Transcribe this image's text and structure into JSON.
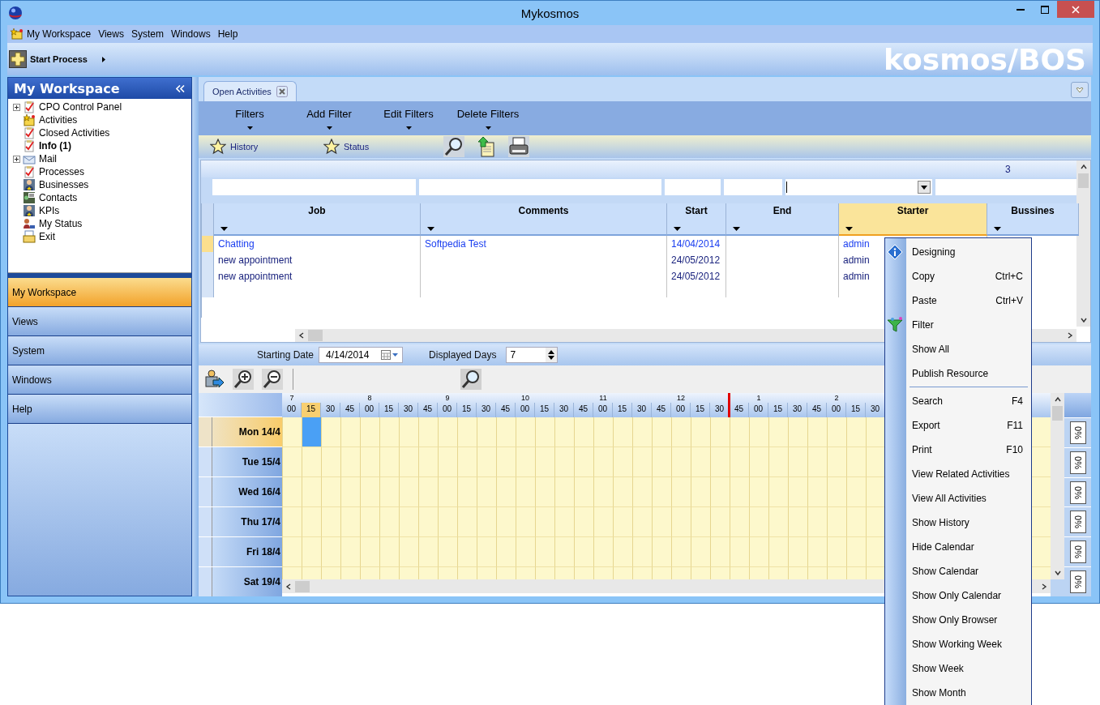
{
  "window": {
    "title": "Mykosmos"
  },
  "menu_bar": [
    {
      "label": "My Workspace"
    },
    {
      "label": "Views"
    },
    {
      "label": "System"
    },
    {
      "label": "Windows"
    },
    {
      "label": "Help"
    }
  ],
  "toolbar": {
    "start_process": "Start Process",
    "logo": "kosmos/BOS"
  },
  "sidebar": {
    "title": "My Workspace",
    "tree": [
      {
        "label": "CPO Control Panel",
        "kind": "checklist",
        "has_children": true,
        "bold": false
      },
      {
        "label": "Activities",
        "kind": "folder",
        "has_children": false,
        "bold": false
      },
      {
        "label": "Closed Activities",
        "kind": "checklist",
        "has_children": false,
        "bold": false
      },
      {
        "label": "Info (1)",
        "kind": "checklist",
        "has_children": false,
        "bold": true
      },
      {
        "label": "Mail",
        "kind": "mail",
        "has_children": true,
        "bold": false
      },
      {
        "label": "Processes",
        "kind": "checklist",
        "has_children": false,
        "bold": false
      },
      {
        "label": "Businesses",
        "kind": "person",
        "has_children": false,
        "bold": false
      },
      {
        "label": "Contacts",
        "kind": "contacts",
        "has_children": false,
        "bold": false
      },
      {
        "label": "KPIs",
        "kind": "person",
        "has_children": false,
        "bold": false
      },
      {
        "label": "My Status",
        "kind": "status",
        "has_children": false,
        "bold": false
      },
      {
        "label": "Exit",
        "kind": "exit",
        "has_children": false,
        "bold": false
      }
    ],
    "nav": [
      {
        "label": "My Workspace",
        "selected": true
      },
      {
        "label": "Views",
        "selected": false
      },
      {
        "label": "System",
        "selected": false
      },
      {
        "label": "Windows",
        "selected": false
      },
      {
        "label": "Help",
        "selected": false
      }
    ]
  },
  "tabs": [
    {
      "label": "Open Activities",
      "selected": true
    }
  ],
  "filter_menu": [
    {
      "label": "Filters"
    },
    {
      "label": "Add Filter"
    },
    {
      "label": "Edit Filters"
    },
    {
      "label": "Delete Filters"
    }
  ],
  "actions": [
    {
      "kind": "star",
      "label": "History"
    },
    {
      "kind": "star",
      "label": "Status"
    },
    {
      "kind": "search"
    },
    {
      "kind": "export"
    },
    {
      "kind": "print"
    }
  ],
  "grid": {
    "record_count": "3",
    "filters": [
      {
        "kind": "text"
      },
      {
        "kind": "text"
      },
      {
        "kind": "text"
      },
      {
        "kind": "text"
      },
      {
        "kind": "dropdown"
      },
      {
        "kind": "text"
      }
    ],
    "columns": [
      {
        "title": "Job",
        "selected": false
      },
      {
        "title": "Comments",
        "selected": false
      },
      {
        "title": "Start",
        "selected": false
      },
      {
        "title": "End",
        "selected": false
      },
      {
        "title": "Starter",
        "selected": true
      },
      {
        "title": "Bussines",
        "selected": false
      }
    ],
    "rows": [
      {
        "selected": true,
        "cells": [
          {
            "text": "Chatting"
          },
          {
            "text": "Softpedia Test"
          },
          {
            "text": "14/04/2014"
          },
          {},
          {
            "text": "admin"
          }
        ]
      },
      {
        "selected": false,
        "cells": [
          {
            "text": "new appointment"
          },
          {},
          {
            "text": "24/05/2012"
          },
          {},
          {
            "text": "admin"
          }
        ]
      },
      {
        "selected": false,
        "cells": [
          {
            "text": "new appointment"
          },
          {},
          {
            "text": "24/05/2012"
          },
          {},
          {
            "text": "admin"
          }
        ]
      }
    ]
  },
  "calendar": {
    "starting_date_label": "Starting Date",
    "starting_date": "4/14/2014",
    "days_label": "Displayed Days",
    "displayed_days": "7",
    "tools": [
      {
        "kind": "user-arrow"
      },
      {
        "kind": "zoom-in"
      },
      {
        "kind": "zoom-out"
      },
      {
        "kind": "search"
      }
    ],
    "hours": [
      {
        "label": "7",
        "minutes": [
          {
            "label": "00",
            "selected": false,
            "now": false
          },
          {
            "label": "15",
            "selected": true,
            "now": false
          },
          {
            "label": "30",
            "selected": false,
            "now": false
          },
          {
            "label": "45",
            "selected": false,
            "now": false
          }
        ]
      },
      {
        "label": "8",
        "minutes": [
          {
            "label": "00",
            "selected": false,
            "now": false
          },
          {
            "label": "15",
            "selected": false,
            "now": false
          },
          {
            "label": "30",
            "selected": false,
            "now": false
          },
          {
            "label": "45",
            "selected": false,
            "now": false
          }
        ]
      },
      {
        "label": "9",
        "minutes": [
          {
            "label": "00",
            "selected": false,
            "now": false
          },
          {
            "label": "15",
            "selected": false,
            "now": false
          },
          {
            "label": "30",
            "selected": false,
            "now": false
          },
          {
            "label": "45",
            "selected": false,
            "now": false
          }
        ]
      },
      {
        "label": "10",
        "minutes": [
          {
            "label": "00",
            "selected": false,
            "now": false
          },
          {
            "label": "15",
            "selected": false,
            "now": false
          },
          {
            "label": "30",
            "selected": false,
            "now": false
          },
          {
            "label": "45",
            "selected": false,
            "now": false
          }
        ]
      },
      {
        "label": "11",
        "minutes": [
          {
            "label": "00",
            "selected": false,
            "now": false
          },
          {
            "label": "15",
            "selected": false,
            "now": false
          },
          {
            "label": "30",
            "selected": false,
            "now": false
          },
          {
            "label": "45",
            "selected": false,
            "now": false
          }
        ]
      },
      {
        "label": "12",
        "minutes": [
          {
            "label": "00",
            "selected": false,
            "now": false
          },
          {
            "label": "15",
            "selected": false,
            "now": false
          },
          {
            "label": "30",
            "selected": false,
            "now": true
          },
          {
            "label": "45",
            "selected": false,
            "now": false
          }
        ]
      },
      {
        "label": "1",
        "minutes": [
          {
            "label": "00",
            "selected": false,
            "now": false
          },
          {
            "label": "15",
            "selected": false,
            "now": false
          },
          {
            "label": "30",
            "selected": false,
            "now": false
          },
          {
            "label": "45",
            "selected": false,
            "now": false
          }
        ]
      },
      {
        "label": "2",
        "minutes": [
          {
            "label": "00",
            "selected": false,
            "now": false
          },
          {
            "label": "15",
            "selected": false,
            "now": false
          },
          {
            "label": "30",
            "selected": false,
            "now": false
          }
        ]
      }
    ],
    "days": [
      {
        "label": "Mon 14/4",
        "selected": true,
        "load": "0%"
      },
      {
        "label": "Tue 15/4",
        "selected": false,
        "load": "0%"
      },
      {
        "label": "Wed 16/4",
        "selected": false,
        "load": "0%"
      },
      {
        "label": "Thu 17/4",
        "selected": false,
        "load": "0%"
      },
      {
        "label": "Fri 18/4",
        "selected": false,
        "load": "0%"
      },
      {
        "label": "Sat 19/4",
        "selected": false,
        "load": "0%"
      }
    ]
  },
  "context_menu": {
    "items": [
      {
        "kind": "info",
        "label": "Designing"
      },
      {
        "kind": "item",
        "label": "Copy",
        "shortcut": "Ctrl+C"
      },
      {
        "kind": "item",
        "label": "Paste",
        "shortcut": "Ctrl+V"
      },
      {
        "kind": "filter",
        "label": "Filter"
      },
      {
        "kind": "item",
        "label": "Show All"
      },
      {
        "kind": "item",
        "label": "Publish Resource"
      },
      {
        "kind": "separator"
      },
      {
        "kind": "item",
        "label": "Search",
        "shortcut": "F4"
      },
      {
        "kind": "item",
        "label": "Export",
        "shortcut": "F11"
      },
      {
        "kind": "item",
        "label": "Print",
        "shortcut": "F10"
      },
      {
        "kind": "item",
        "label": "View Related Activities"
      },
      {
        "kind": "item",
        "label": "View All Activities"
      },
      {
        "kind": "item",
        "label": "Show History"
      },
      {
        "kind": "item",
        "label": "Hide Calendar"
      },
      {
        "kind": "item",
        "label": "Show Calendar"
      },
      {
        "kind": "item",
        "label": "Show Only Calendar"
      },
      {
        "kind": "item",
        "label": "Show Only Browser"
      },
      {
        "kind": "item",
        "label": "Show Working Week"
      },
      {
        "kind": "item",
        "label": "Show Week"
      },
      {
        "kind": "item",
        "label": "Show Month"
      }
    ]
  }
}
